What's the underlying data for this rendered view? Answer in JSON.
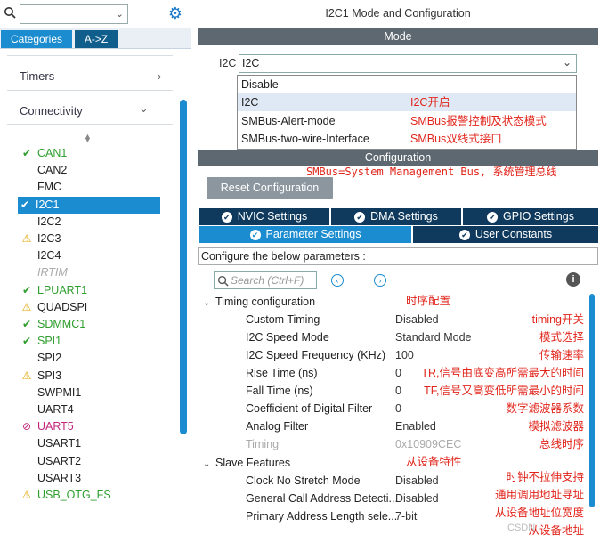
{
  "left": {
    "search": {
      "value": "",
      "placeholder": ""
    },
    "tabs": {
      "categories": "Categories",
      "az": "A->Z"
    },
    "categories": [
      {
        "label": "Timers",
        "chevron": "›"
      },
      {
        "label": "Connectivity",
        "chevron": "⌄"
      }
    ],
    "peripherals": [
      {
        "label": "CAN1",
        "status": "ok"
      },
      {
        "label": "CAN2",
        "status": "none"
      },
      {
        "label": "FMC",
        "status": "none"
      },
      {
        "label": "I2C1",
        "status": "selected"
      },
      {
        "label": "I2C2",
        "status": "none"
      },
      {
        "label": "I2C3",
        "status": "warn"
      },
      {
        "label": "I2C4",
        "status": "none"
      },
      {
        "label": "IRTIM",
        "status": "disabled"
      },
      {
        "label": "LPUART1",
        "status": "ok"
      },
      {
        "label": "QUADSPI",
        "status": "warn"
      },
      {
        "label": "SDMMC1",
        "status": "ok"
      },
      {
        "label": "SPI1",
        "status": "ok"
      },
      {
        "label": "SPI2",
        "status": "none"
      },
      {
        "label": "SPI3",
        "status": "warn"
      },
      {
        "label": "SWPMI1",
        "status": "none"
      },
      {
        "label": "UART4",
        "status": "none"
      },
      {
        "label": "UART5",
        "status": "blocked"
      },
      {
        "label": "USART1",
        "status": "none"
      },
      {
        "label": "USART2",
        "status": "none"
      },
      {
        "label": "USART3",
        "status": "none"
      },
      {
        "label": "USB_OTG_FS",
        "status": "warn"
      }
    ]
  },
  "right": {
    "title": "I2C1 Mode and Configuration",
    "mode_header": "Mode",
    "i2c_label": "I2C",
    "i2c_value": "I2C",
    "options": [
      "Disable",
      "I2C",
      "SMBus-Alert-mode",
      "SMBus-two-wire-Interface"
    ],
    "option_notes": [
      "",
      "I2C开启",
      "SMBus报警控制及状态模式",
      "SMBus双线式接口"
    ],
    "config_header": "Configuration",
    "smbus_note": "SMBus=System Management Bus, 系统管理总线",
    "reset_button": "Reset Configuration",
    "tabs_row1": [
      "NVIC Settings",
      "DMA Settings",
      "GPIO Settings"
    ],
    "tabs_row2": [
      "Parameter Settings",
      "User Constants"
    ],
    "configure_text": "Configure the below parameters :",
    "search_placeholder": "Search (Ctrl+F)",
    "groups": {
      "timing": "Timing configuration",
      "slave": "Slave Features"
    },
    "timing_note": "时序配置",
    "slave_note": "从设备特性",
    "params": [
      {
        "name": "Custom Timing",
        "value": "Disabled",
        "note": "timing开关",
        "dim": false
      },
      {
        "name": "I2C Speed Mode",
        "value": "Standard Mode",
        "note": "模式选择",
        "dim": false
      },
      {
        "name": "I2C Speed Frequency (KHz)",
        "value": "100",
        "note": "传输速率",
        "dim": false
      },
      {
        "name": "Rise Time (ns)",
        "value": "0",
        "note": "TR,信号由底变高所需最大的时间",
        "dim": false
      },
      {
        "name": "Fall Time (ns)",
        "value": "0",
        "note": "TF,信号又高变低所需最小的时间",
        "dim": false
      },
      {
        "name": "Coefficient of Digital Filter",
        "value": "0",
        "note": "数字滤波器系数",
        "dim": false
      },
      {
        "name": "Analog Filter",
        "value": "Enabled",
        "note": "模拟滤波器",
        "dim": false
      },
      {
        "name": "Timing",
        "value": "0x10909CEC",
        "note": "总线时序",
        "dim": true
      }
    ],
    "slave_params": [
      {
        "name": "Clock No Stretch Mode",
        "value": "Disabled",
        "note": "时钟不拉伸支持"
      },
      {
        "name": "General Call Address Detecti...",
        "value": "Disabled",
        "note": "通用调用地址寻址"
      },
      {
        "name": "Primary Address Length sele...",
        "value": "7-bit",
        "note": "从设备地址位宽度"
      },
      {
        "name": "",
        "value": "",
        "note": "从设备地址"
      }
    ],
    "watermark": "CSDN"
  }
}
